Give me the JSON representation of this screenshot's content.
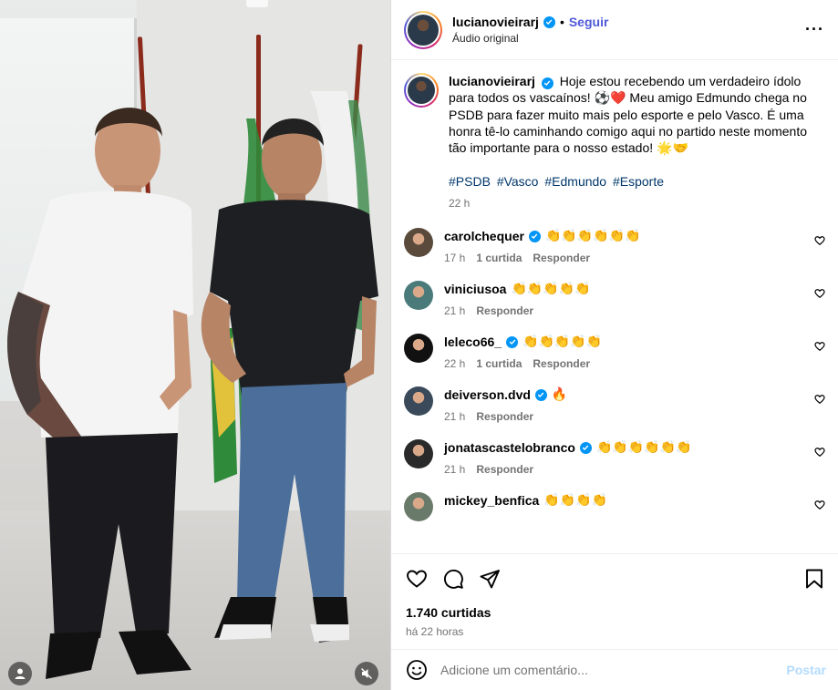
{
  "header": {
    "username": "lucianovieirarj",
    "separator": "•",
    "follow_label": "Seguir",
    "audio_label": "Áudio original",
    "more_icon": "more-horizontal-icon"
  },
  "caption": {
    "username": "lucianovieirarj",
    "text_1": "Hoje estou recebendo um verdadeiro ídolo para todos os vascaínos!",
    "emoji_1": "⚽❤️",
    "text_2": "Meu amigo Edmundo chega no PSDB para fazer muito mais pelo esporte e pelo Vasco. É uma honra tê-lo caminhando comigo aqui no partido neste momento tão importante para o nosso estado!",
    "emoji_2": "🌟🤝",
    "hashtags": [
      "#PSDB",
      "#Vasco",
      "#Edmundo",
      "#Esporte"
    ],
    "time": "22 h"
  },
  "comments": [
    {
      "username": "carolchequer",
      "verified": true,
      "text": "👏👏👏👏👏👏",
      "time": "17 h",
      "likes": "1 curtida",
      "reply": "Responder",
      "avatar_color": "#5a4a3c"
    },
    {
      "username": "viniciusoa",
      "verified": false,
      "text": "👏👏👏👏👏",
      "time": "21 h",
      "likes": "",
      "reply": "Responder",
      "avatar_color": "#4a7a7a"
    },
    {
      "username": "leleco66_",
      "verified": true,
      "text": "👏👏👏👏👏",
      "time": "22 h",
      "likes": "1 curtida",
      "reply": "Responder",
      "avatar_color": "#111111"
    },
    {
      "username": "deiverson.dvd",
      "verified": true,
      "text": "🔥",
      "time": "21 h",
      "likes": "",
      "reply": "Responder",
      "avatar_color": "#3a4a5a"
    },
    {
      "username": "jonatascastelobranco",
      "verified": true,
      "text": "👏👏👏👏👏👏",
      "time": "21 h",
      "likes": "",
      "reply": "Responder",
      "avatar_color": "#2a2a2a"
    },
    {
      "username": "mickey_benfica",
      "verified": false,
      "text": "👏👏👏👏",
      "time": "",
      "likes": "",
      "reply": "",
      "avatar_color": "#6a7a6a"
    }
  ],
  "actions": {
    "like_icon": "heart-icon",
    "comment_icon": "comment-icon",
    "share_icon": "share-icon",
    "save_icon": "bookmark-icon",
    "likes_count": "1.740 curtidas",
    "posted_ago": "há 22 horas"
  },
  "add_comment": {
    "placeholder": "Adicione um comentário...",
    "post_label": "Postar"
  },
  "media": {
    "user_tag_icon": "user-tag-icon",
    "mute_icon": "muted-speaker-icon"
  },
  "colors": {
    "accent": "#0095f6",
    "follow": "#4f5ad8",
    "hashtag": "#00376b",
    "muted_text": "#737373",
    "post_disabled": "#b3dbff"
  }
}
